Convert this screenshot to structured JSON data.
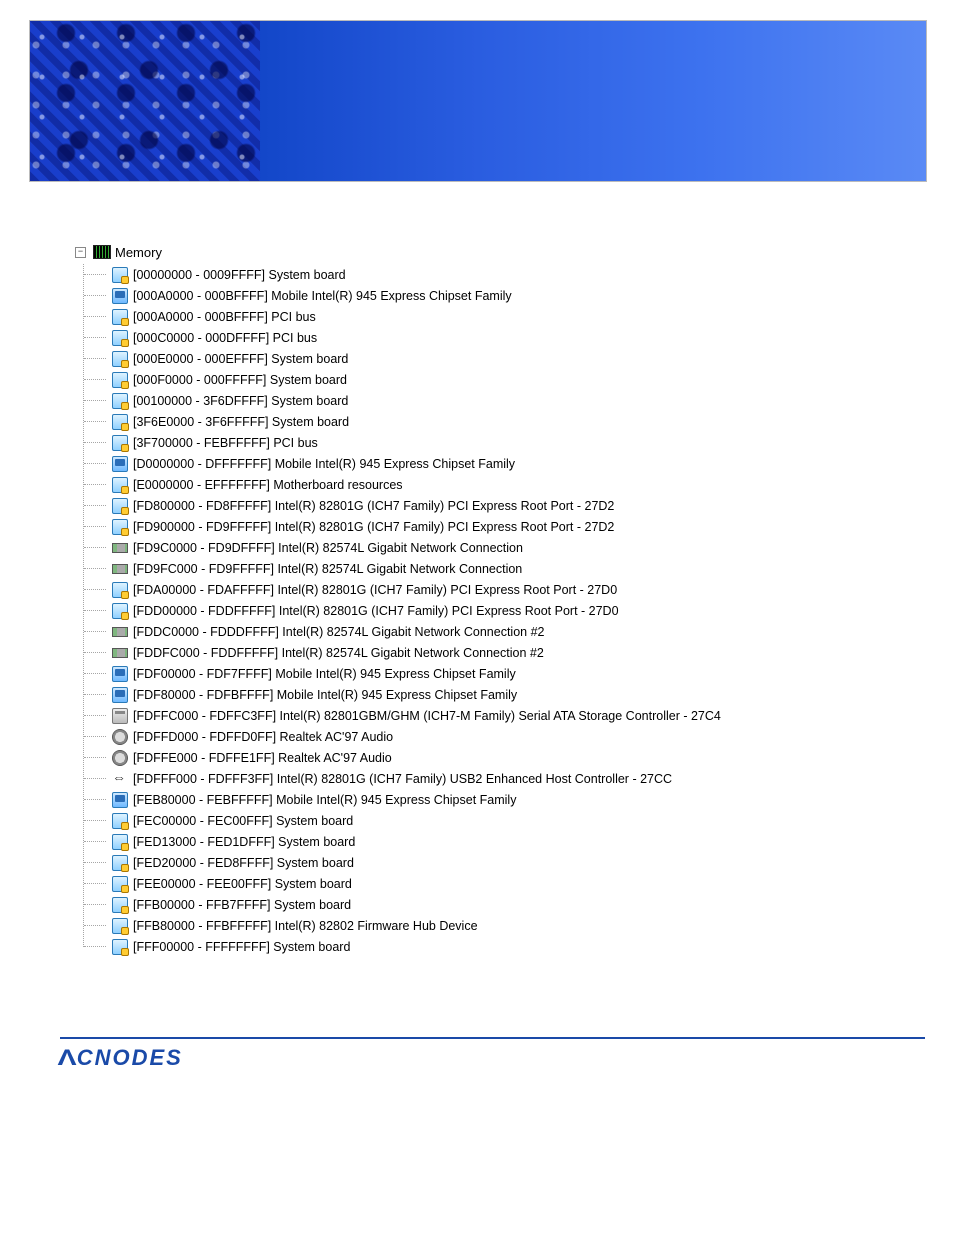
{
  "root": {
    "label": "Memory"
  },
  "items": [
    {
      "icon": "system",
      "range": "[00000000 - 0009FFFF]",
      "desc": "System board"
    },
    {
      "icon": "display",
      "range": "[000A0000 - 000BFFFF]",
      "desc": "Mobile Intel(R) 945 Express Chipset Family"
    },
    {
      "icon": "system",
      "range": "[000A0000 - 000BFFFF]",
      "desc": "PCI bus"
    },
    {
      "icon": "system",
      "range": "[000C0000 - 000DFFFF]",
      "desc": "PCI bus"
    },
    {
      "icon": "system",
      "range": "[000E0000 - 000EFFFF]",
      "desc": "System board"
    },
    {
      "icon": "system",
      "range": "[000F0000 - 000FFFFF]",
      "desc": "System board"
    },
    {
      "icon": "system",
      "range": "[00100000 - 3F6DFFFF]",
      "desc": "System board"
    },
    {
      "icon": "system",
      "range": "[3F6E0000 - 3F6FFFFF]",
      "desc": "System board"
    },
    {
      "icon": "system",
      "range": "[3F700000 - FEBFFFFF]",
      "desc": "PCI bus"
    },
    {
      "icon": "display",
      "range": "[D0000000 - DFFFFFFF]",
      "desc": "Mobile Intel(R) 945 Express Chipset Family"
    },
    {
      "icon": "system",
      "range": "[E0000000 - EFFFFFFF]",
      "desc": "Motherboard resources"
    },
    {
      "icon": "system",
      "range": "[FD800000 - FD8FFFFF]",
      "desc": "Intel(R) 82801G (ICH7 Family) PCI Express Root Port - 27D2"
    },
    {
      "icon": "system",
      "range": "[FD900000 - FD9FFFFF]",
      "desc": "Intel(R) 82801G (ICH7 Family) PCI Express Root Port - 27D2"
    },
    {
      "icon": "network",
      "range": "[FD9C0000 - FD9DFFFF]",
      "desc": "Intel(R) 82574L Gigabit Network Connection"
    },
    {
      "icon": "network",
      "range": "[FD9FC000 - FD9FFFFF]",
      "desc": "Intel(R) 82574L Gigabit Network Connection"
    },
    {
      "icon": "system",
      "range": "[FDA00000 - FDAFFFFF]",
      "desc": "Intel(R) 82801G (ICH7 Family) PCI Express Root Port - 27D0"
    },
    {
      "icon": "system",
      "range": "[FDD00000 - FDDFFFFF]",
      "desc": "Intel(R) 82801G (ICH7 Family) PCI Express Root Port - 27D0"
    },
    {
      "icon": "network",
      "range": "[FDDC0000 - FDDDFFFF]",
      "desc": "Intel(R) 82574L Gigabit Network Connection #2"
    },
    {
      "icon": "network",
      "range": "[FDDFC000 - FDDFFFFF]",
      "desc": "Intel(R) 82574L Gigabit Network Connection #2"
    },
    {
      "icon": "display",
      "range": "[FDF00000 - FDF7FFFF]",
      "desc": "Mobile Intel(R) 945 Express Chipset Family"
    },
    {
      "icon": "display",
      "range": "[FDF80000 - FDFBFFFF]",
      "desc": "Mobile Intel(R) 945 Express Chipset Family"
    },
    {
      "icon": "storage",
      "range": "[FDFFC000 - FDFFC3FF]",
      "desc": "Intel(R) 82801GBM/GHM (ICH7-M Family) Serial ATA Storage Controller - 27C4"
    },
    {
      "icon": "audio",
      "range": "[FDFFD000 - FDFFD0FF]",
      "desc": "Realtek AC'97 Audio"
    },
    {
      "icon": "audio",
      "range": "[FDFFE000 - FDFFE1FF]",
      "desc": "Realtek AC'97 Audio"
    },
    {
      "icon": "usb",
      "range": "[FDFFF000 - FDFFF3FF]",
      "desc": "Intel(R) 82801G (ICH7 Family) USB2 Enhanced Host Controller - 27CC"
    },
    {
      "icon": "display",
      "range": "[FEB80000 - FEBFFFFF]",
      "desc": "Mobile Intel(R) 945 Express Chipset Family"
    },
    {
      "icon": "system",
      "range": "[FEC00000 - FEC00FFF]",
      "desc": "System board"
    },
    {
      "icon": "system",
      "range": "[FED13000 - FED1DFFF]",
      "desc": "System board"
    },
    {
      "icon": "system",
      "range": "[FED20000 - FED8FFFF]",
      "desc": "System board"
    },
    {
      "icon": "system",
      "range": "[FEE00000 - FEE00FFF]",
      "desc": "System board"
    },
    {
      "icon": "system",
      "range": "[FFB00000 - FFB7FFFF]",
      "desc": "System board"
    },
    {
      "icon": "system",
      "range": "[FFB80000 - FFBFFFFF]",
      "desc": "Intel(R) 82802 Firmware Hub Device"
    },
    {
      "icon": "system",
      "range": "[FFF00000 - FFFFFFFF]",
      "desc": "System board"
    }
  ],
  "footer": {
    "brand": "CNODES"
  }
}
